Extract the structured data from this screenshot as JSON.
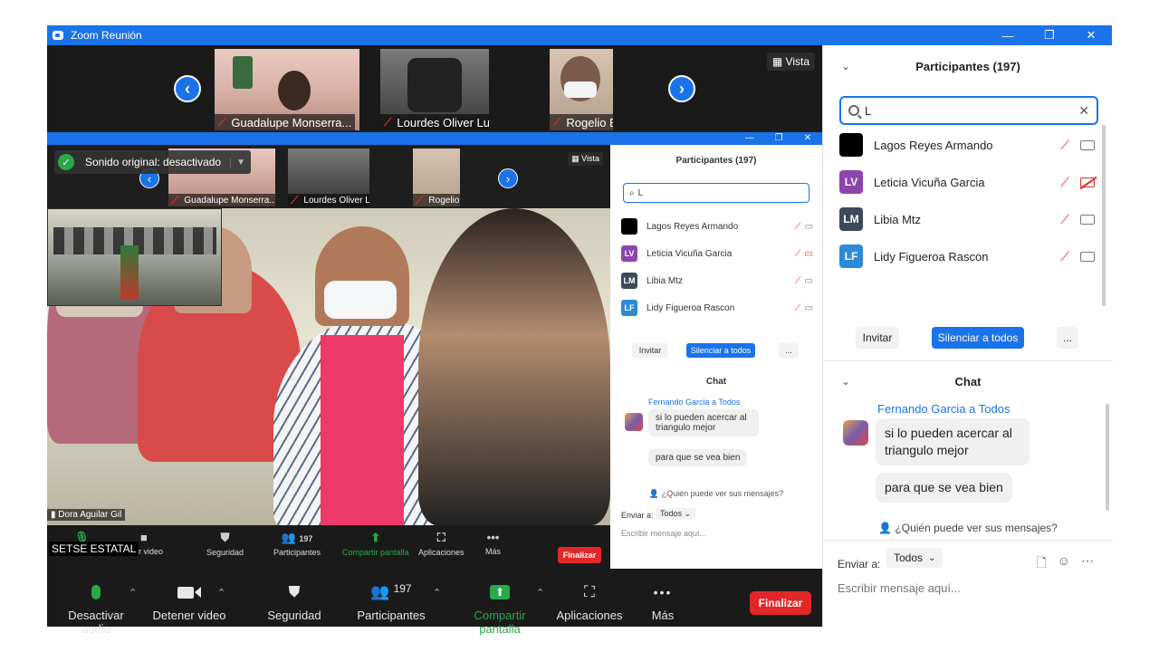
{
  "window": {
    "title": "Zoom Reunión",
    "controls": [
      "—",
      "❐",
      "✕"
    ]
  },
  "filmstrip": {
    "participants": [
      {
        "name": "Guadalupe Monserra..."
      },
      {
        "name": "Lourdes Oliver Lucas"
      },
      {
        "name": "Rogelio Estrada"
      }
    ],
    "view_label": "Vista"
  },
  "shared_screen": {
    "window_title": "Zoom Reunión",
    "original_sound": "Sonido original: desactivado",
    "thumbs": [
      {
        "name": "Guadalupe Monserra..."
      },
      {
        "name": "Lourdes Oliver Lucas"
      },
      {
        "name": "Rogelio Estrada"
      }
    ],
    "view_label": "Vista",
    "speaker_label": "Dora Aguilar Gil",
    "overlay_label": "SETSE ESTATAL",
    "toolbar": {
      "audio": "Desactivar audio",
      "video": "Detener video",
      "security": "Seguridad",
      "participants": "Participantes",
      "participants_count": "197",
      "share": "Compartir pantalla",
      "apps": "Aplicaciones",
      "more": "Más",
      "end": "Finalizar"
    },
    "panel": {
      "title": "Participantes (197)",
      "search_value": "L",
      "participants": [
        {
          "initials": "",
          "name": "Lagos Reyes Armando",
          "color": "#000000"
        },
        {
          "initials": "LV",
          "name": "Leticia Vicuña Garcia",
          "color": "#8e44ad"
        },
        {
          "initials": "LM",
          "name": "Libia Mtz",
          "color": "#3d4a5c"
        },
        {
          "initials": "LF",
          "name": "Lidy Figueroa Rascon",
          "color": "#2d8ad6"
        }
      ],
      "invite": "Invitar",
      "mute_all": "Silenciar a todos",
      "more": "...",
      "chat_title": "Chat",
      "sender": "Fernando Garcia a Todos",
      "messages": [
        "si lo pueden acercar al triangulo mejor",
        "para que se vea bien"
      ],
      "who_can_see": "¿Quién puede ver sus mensajes?",
      "send_to": "Enviar a:",
      "recipient": "Todos",
      "placeholder": "Escribir mensaje aquí..."
    }
  },
  "panel": {
    "participants_title": "Participantes (197)",
    "search_value": "L",
    "participants": [
      {
        "initials": "",
        "name": "Lagos Reyes Armando",
        "color": "#000000",
        "video_off": false
      },
      {
        "initials": "LV",
        "name": "Leticia Vicuña Garcia",
        "color": "#8e44ad",
        "video_off": true
      },
      {
        "initials": "LM",
        "name": "Libia Mtz",
        "color": "#3d4a5c",
        "video_off": false
      },
      {
        "initials": "LF",
        "name": "Lidy Figueroa Rascon",
        "color": "#2d8ad6",
        "video_off": false
      }
    ],
    "invite": "Invitar",
    "mute_all": "Silenciar a todos",
    "more": "...",
    "chat_title": "Chat",
    "sender": "Fernando Garcia a Todos",
    "messages": [
      "si lo pueden acercar al triangulo mejor",
      "para que se vea bien"
    ],
    "who_can_see": "¿Quién puede ver sus mensajes?",
    "send_to": "Enviar a:",
    "recipient": "Todos",
    "placeholder": "Escribir mensaje aquí..."
  },
  "toolbar": {
    "audio": "Desactivar audio",
    "video": "Detener video",
    "security": "Seguridad",
    "participants": "Participantes",
    "participants_count": "197",
    "share": "Compartir pantalla",
    "apps": "Aplicaciones",
    "more": "Más",
    "end": "Finalizar"
  },
  "colors": {
    "accent": "#1a73e8",
    "danger": "#e02828",
    "success": "#2aa84a",
    "toolbar_bg": "#1a1a1a"
  }
}
